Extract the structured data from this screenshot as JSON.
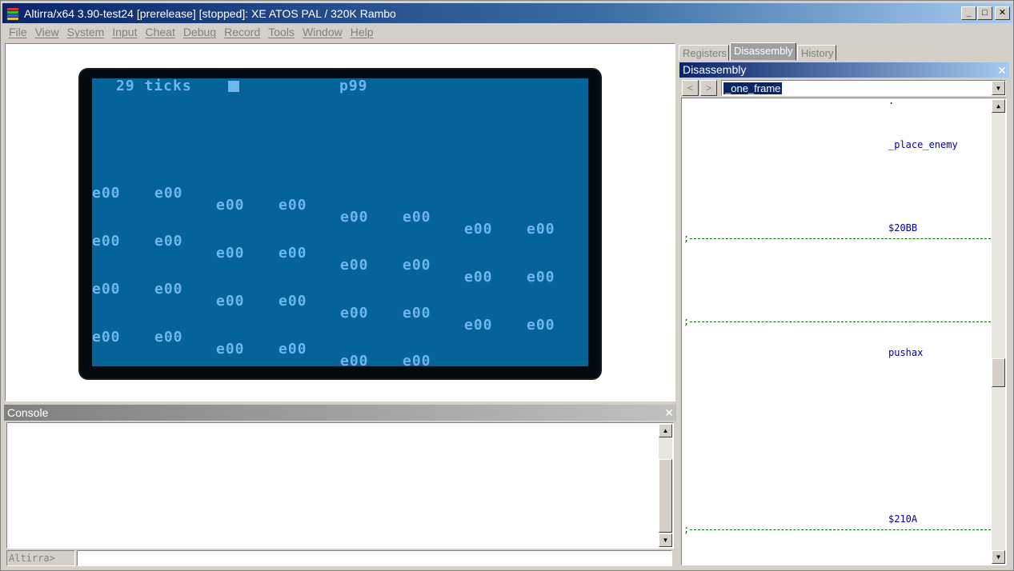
{
  "window": {
    "title": "Altirra/x64 3.90-test24 [prerelease] [stopped]: XE ATOS PAL / 320K Rambo",
    "min_glyph": "_",
    "max_glyph": "□",
    "close_glyph": "✕"
  },
  "menu": [
    "File",
    "View",
    "System",
    "Input",
    "Cheat",
    "Debug",
    "Record",
    "Tools",
    "Window",
    "Help"
  ],
  "screen": {
    "status_left": "29 ticks",
    "status_right": "p99",
    "enemy_text": "e00"
  },
  "console": {
    "title": "Console",
    "prompt": "Altirra>",
    "input_value": ""
  },
  "tabs": [
    "Registers",
    "Disassembly",
    "History"
  ],
  "disassembly": {
    "title": "Disassembly",
    "back_label": "<",
    "forward_label": ">",
    "address_value": "_one_frame",
    "dot": ".",
    "labels": [
      "_place_enemy",
      "$20BB",
      "pushax",
      "$210A"
    ],
    "separator": ";"
  },
  "icons": {
    "close": "close-icon",
    "scroll_up": "arrow-up-icon",
    "scroll_down": "arrow-down-icon",
    "dropdown": "chevron-down-icon"
  },
  "colors": {
    "screen_bg": "#046499",
    "screen_fg": "#6fb6ea",
    "label": "#0000a0",
    "separator": "#007000"
  }
}
